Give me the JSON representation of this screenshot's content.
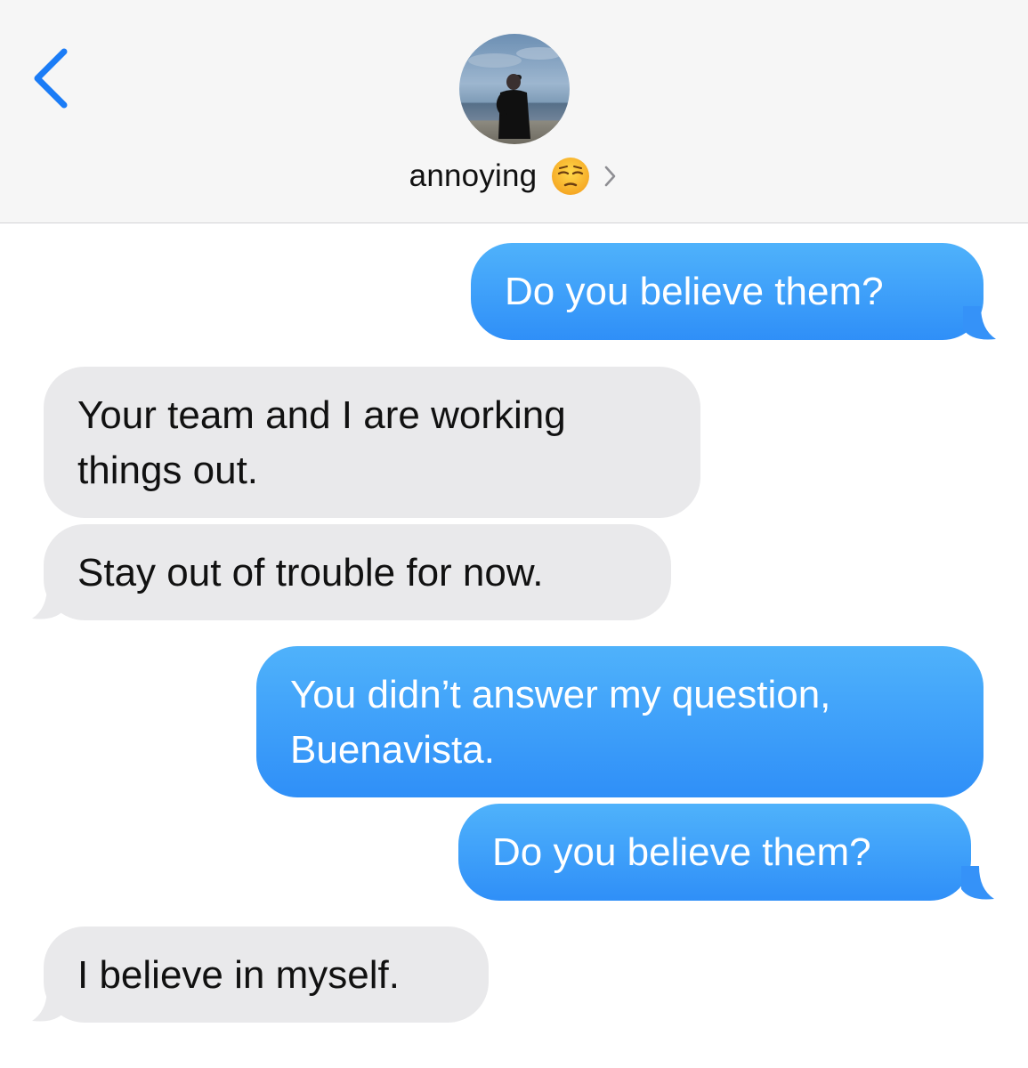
{
  "header": {
    "back_label": "Back",
    "contact_name": "annoying",
    "contact_emoji": "unamused-face-icon",
    "chevron": "chevron-right-icon"
  },
  "colors": {
    "sent_bubble": "#3b9ff9",
    "received_bubble": "#e9e9eb",
    "ios_blue": "#1b7cf6"
  },
  "messages": [
    {
      "direction": "sent",
      "text": "Do you believe them?"
    },
    {
      "direction": "received",
      "text": "Your team and I are working things out."
    },
    {
      "direction": "received",
      "text": "Stay out of trouble for now."
    },
    {
      "direction": "sent",
      "text": "You didn’t answer my question, Buenavista."
    },
    {
      "direction": "sent",
      "text": "Do you believe them?"
    },
    {
      "direction": "received",
      "text": "I believe in myself."
    }
  ]
}
